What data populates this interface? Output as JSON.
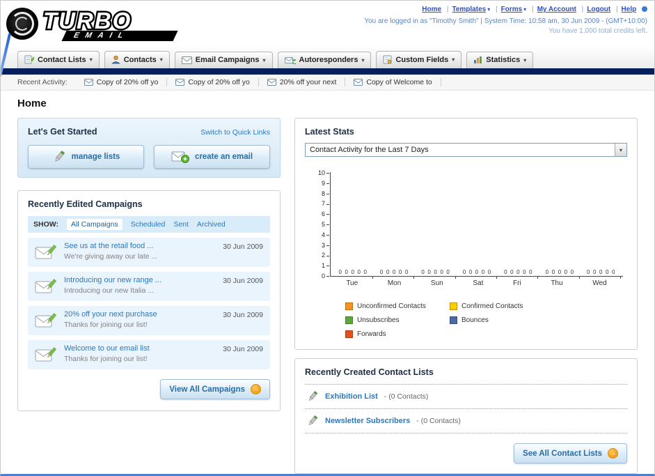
{
  "header": {
    "logo_top": "TURBO",
    "logo_bottom": "EMAIL",
    "nav_links": [
      {
        "label": "Home"
      },
      {
        "label": "Templates"
      },
      {
        "label": "Forms"
      },
      {
        "label": "My Account"
      },
      {
        "label": "Logout"
      },
      {
        "label": "Help"
      }
    ],
    "login_info": "You are logged in as \"Timothy Smith\" | System Time: 10:58 am, 30 Jun 2009 - (GMT+10:00)",
    "credits_info": "You have 1,000 total credits left."
  },
  "main_nav": {
    "tabs": [
      {
        "label": "Contact Lists"
      },
      {
        "label": "Contacts"
      },
      {
        "label": "Email Campaigns"
      },
      {
        "label": "Autoresponders"
      },
      {
        "label": "Custom Fields"
      },
      {
        "label": "Statistics"
      }
    ]
  },
  "recent_activity": {
    "label": "Recent Activity:",
    "items": [
      {
        "label": "Copy of 20% off yo"
      },
      {
        "label": "Copy of 20% off yo"
      },
      {
        "label": "20% off your next"
      },
      {
        "label": "Copy of Welcome to"
      }
    ]
  },
  "page": {
    "title": "Home"
  },
  "get_started": {
    "title": "Let's Get Started",
    "switch_link": "Switch to Quick Links",
    "manage_lists_button": "manage lists",
    "create_email_button": "create an email"
  },
  "campaigns": {
    "title": "Recently Edited Campaigns",
    "show_label": "SHOW:",
    "tabs": [
      {
        "label": "All Campaigns"
      },
      {
        "label": "Scheduled"
      },
      {
        "label": "Sent"
      },
      {
        "label": "Archived"
      }
    ],
    "items": [
      {
        "title": "See us at the retail food ...",
        "subtitle": "We're giving away our late ...",
        "date": "30 Jun 2009"
      },
      {
        "title": "Introducing our new range ...",
        "subtitle": "Introducing our new Italia ...",
        "date": "30 Jun 2009"
      },
      {
        "title": "20% off your next purchase",
        "subtitle": "Thanks for joining our list!",
        "date": "30 Jun 2009"
      },
      {
        "title": "Welcome to our email list",
        "subtitle": "Thanks for joining our list!",
        "date": "30 Jun 2009"
      }
    ],
    "view_all_button": "View All Campaigns"
  },
  "stats": {
    "title": "Latest Stats",
    "filter_value": "Contact Activity for the Last 7 Days"
  },
  "chart_data": {
    "type": "bar",
    "title": "Contact Activity for the Last 7 Days",
    "categories": [
      "Tue",
      "Mon",
      "Sun",
      "Sat",
      "Fri",
      "Thu",
      "Wed"
    ],
    "series": [
      {
        "name": "Unconfirmed Contacts",
        "color": "#F7941E",
        "values": [
          0,
          0,
          0,
          0,
          0,
          0,
          0
        ]
      },
      {
        "name": "Confirmed Contacts",
        "color": "#FFCB05",
        "values": [
          0,
          0,
          0,
          0,
          0,
          0,
          0
        ]
      },
      {
        "name": "Unsubscribes",
        "color": "#5FA73B",
        "values": [
          0,
          0,
          0,
          0,
          0,
          0,
          0
        ]
      },
      {
        "name": "Bounces",
        "color": "#4A69A5",
        "values": [
          0,
          0,
          0,
          0,
          0,
          0,
          0
        ]
      },
      {
        "name": "Forwards",
        "color": "#E1501E",
        "values": [
          0,
          0,
          0,
          0,
          0,
          0,
          0
        ]
      }
    ],
    "ylim": [
      0,
      10
    ],
    "ytick_step": 1,
    "grid": false,
    "legend_position": "bottom"
  },
  "contact_lists": {
    "title": "Recently Created Contact Lists",
    "items": [
      {
        "name": "Exhibition List",
        "detail": "- (0 Contacts)"
      },
      {
        "name": "Newsletter Subscribers",
        "detail": "- (0 Contacts)"
      }
    ],
    "see_all_button": "See All Contact Lists"
  }
}
